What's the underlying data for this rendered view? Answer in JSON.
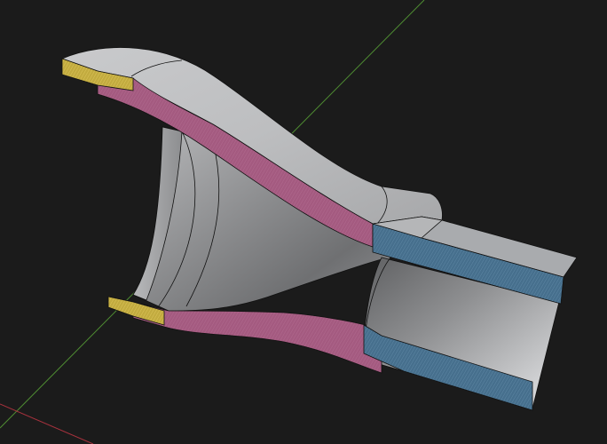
{
  "viewport": {
    "background_color": "#1b1b1b",
    "axes": {
      "x_axis_color": "#a7323d",
      "y_axis_color": "#4f8d32"
    }
  },
  "model": {
    "surface_color": "#a9abae",
    "cut_face_pink": "#a45a80",
    "cut_face_yellow": "#c7b044",
    "cut_face_blue": "#466f8d"
  }
}
